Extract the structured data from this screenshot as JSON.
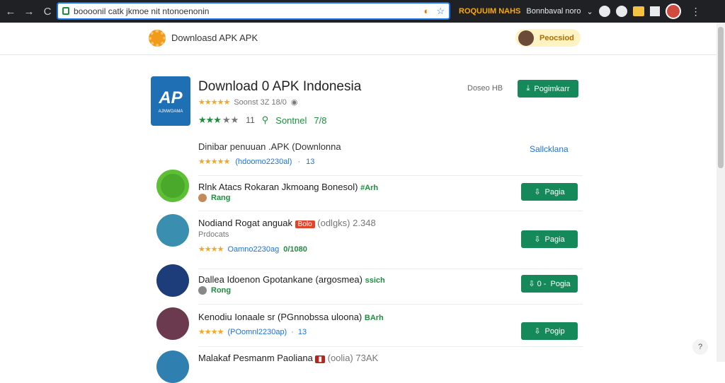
{
  "browser": {
    "url": "boooonil catk jkmoe nit ntonoenonin",
    "ext_label_1": "ROQUUIM NAHS",
    "ext_label_2": "Bonnbaval noro",
    "chevron": "⌄"
  },
  "site": {
    "title": "Downloasd APK APK",
    "pill_label": "Peocsiod"
  },
  "app": {
    "icon_letters": "AP",
    "icon_caption": "AJNWOAMA",
    "title": "Download 0 APK Indonesia",
    "sub_text": "Soonst 3Z 18/0",
    "rating_count": "11",
    "meta_label": "Sontnel",
    "meta_value": "7/8",
    "size": "Doseo HB",
    "download_label": "Pogimkarr"
  },
  "section": {
    "title": "Dinibar penuuan .APK (Downlonna",
    "link": "Sallcklana",
    "meta_code": "(hdoomo2230al)",
    "meta_count": "13"
  },
  "rows": [
    {
      "title": "Rlnk Atacs Rokaran Jkmoang Bonesol)",
      "tag": "#Arh",
      "sub_label": "Rang",
      "button": "Pagia",
      "button_icon": "⇩"
    },
    {
      "title": "Nodiand Rogat anguak",
      "badge": "Bolo",
      "title_tail": "(odlgks)",
      "count": "2.348",
      "sub_label": "Prdocats",
      "code": "Oamno2230ag",
      "extra": "0/1080",
      "button": "Pagia",
      "button_icon": "⇩"
    },
    {
      "title": "Dallea Idoenon Gpotankane (argosmea)",
      "tag": "ssich",
      "sub_label": "Rong",
      "button": "Pogia",
      "button_icon": "⇩ 0 -"
    },
    {
      "title": "Kenodiu Ionaale sr (PGnnobssa uloona)",
      "tag": "BArh",
      "code": "(POomnl2230ap)",
      "count": "13",
      "button": "Pogip",
      "button_icon": "⇩"
    },
    {
      "title": "Malakaf Pesmanm Paoliana",
      "title_tail": "(oolia)",
      "extra": "73AK"
    }
  ],
  "help": "?",
  "colors": {
    "accent_green": "#16895b",
    "star": "#f5a623",
    "link_blue": "#1a73e8"
  }
}
